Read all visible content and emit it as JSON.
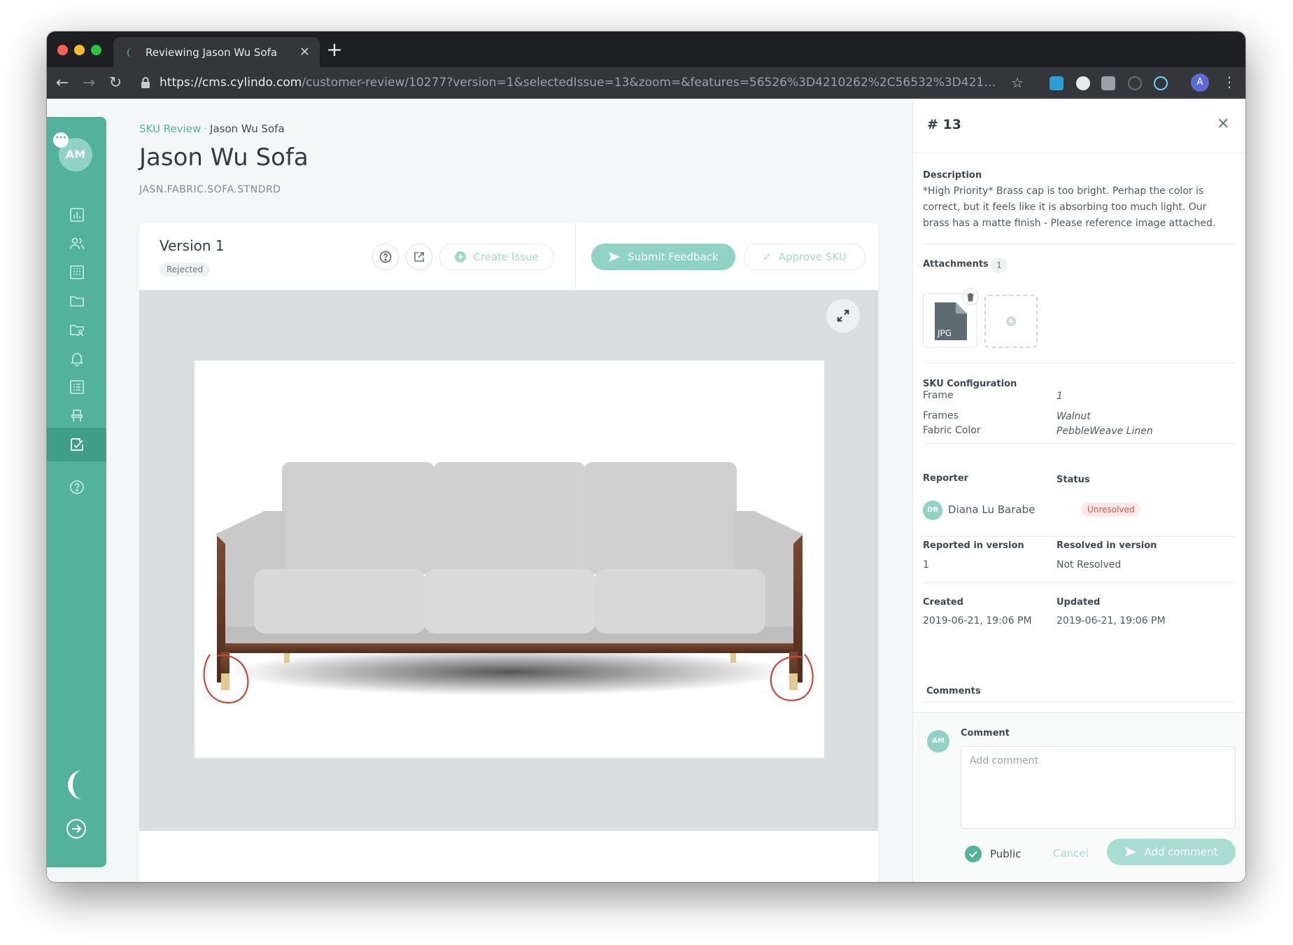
{
  "browser": {
    "tab_title": "Reviewing Jason Wu Sofa",
    "url_host": "https://cms.cylindo.com",
    "url_path": "/customer-review/10277?version=1&selectedIssue=13&zoom=&features=56526%3D4210262%2C56532%3D4210306&frame...",
    "profile_initial": "A"
  },
  "sidebar": {
    "avatar_initials": "AM",
    "chat_badge": "···",
    "items": [
      {
        "icon": "chart-icon"
      },
      {
        "icon": "users-icon"
      },
      {
        "icon": "building-icon"
      },
      {
        "icon": "folder-icon"
      },
      {
        "icon": "folder-user-icon"
      },
      {
        "icon": "bell-icon"
      },
      {
        "icon": "list-icon"
      },
      {
        "icon": "chair-icon"
      },
      {
        "icon": "review-check-icon",
        "active": true
      },
      {
        "icon": "help-icon"
      }
    ]
  },
  "breadcrumb": {
    "root": "SKU Review",
    "separator": "·",
    "current": "Jason Wu Sofa"
  },
  "product": {
    "title": "Jason Wu Sofa",
    "sku": "JASN.FABRIC.SOFA.STNDRD"
  },
  "version": {
    "title": "Version 1",
    "status": "Rejected",
    "create_issue_label": "Create Issue",
    "submit_feedback_label": "Submit Feedback",
    "approve_label": "Approve SKU"
  },
  "issue": {
    "number": "# 13",
    "description_label": "Description",
    "description": "*High Priority* Brass cap is too bright. Perhap the color is correct, but it feels like it is absorbing too much light. Our brass has a matte finish - Please reference image attached.",
    "attachments_label": "Attachments",
    "attachments_count": "1",
    "attachment_type": "JPG",
    "sku_config_label": "SKU Configuration",
    "config": [
      {
        "key": "Frame",
        "value": "1"
      },
      {
        "key": "Frames",
        "value": "Walnut"
      },
      {
        "key": "Fabric Color",
        "value": "PebbleWeave Linen"
      }
    ],
    "reporter_label": "Reporter",
    "reporter_initials": "DB",
    "reporter_name": "Diana Lu Barabe",
    "status_label": "Status",
    "status": "Unresolved",
    "reported_in_label": "Reported in version",
    "reported_in": "1",
    "resolved_in_label": "Resolved in version",
    "resolved_in": "Not Resolved",
    "created_label": "Created",
    "created": "2019-06-21, 19:06 PM",
    "updated_label": "Updated",
    "updated": "2019-06-21, 19:06 PM",
    "comments_label": "Comments"
  },
  "comment_form": {
    "avatar_initials": "AM",
    "label": "Comment",
    "placeholder": "Add comment",
    "public_label": "Public",
    "cancel_label": "Cancel",
    "submit_label": "Add comment"
  },
  "colors": {
    "brand": "#52b29c",
    "brand_light": "#8fd3c4",
    "unresolved": "#d9534f"
  }
}
